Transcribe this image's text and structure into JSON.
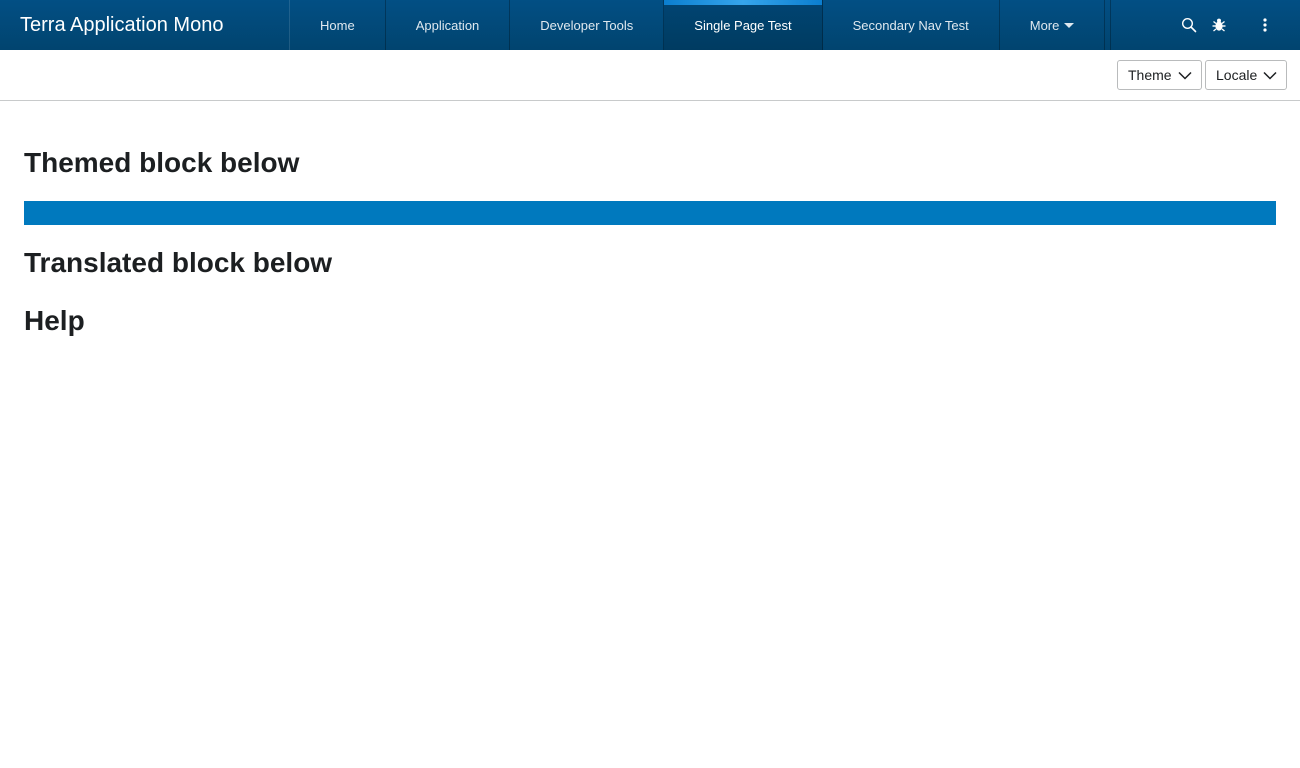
{
  "header": {
    "app_title": "Terra Application Mono",
    "tabs": [
      {
        "label": "Home",
        "active": false
      },
      {
        "label": "Application",
        "active": false
      },
      {
        "label": "Developer Tools",
        "active": false
      },
      {
        "label": "Single Page Test",
        "active": true
      },
      {
        "label": "Secondary Nav Test",
        "active": false
      },
      {
        "label": "More",
        "active": false
      }
    ],
    "utility_icons": [
      "search-icon",
      "bug-icon",
      "more-vertical-icon"
    ]
  },
  "toolbar": {
    "theme_label": "Theme",
    "locale_label": "Locale"
  },
  "main": {
    "themed_heading": "Themed block below",
    "translated_heading": "Translated block below",
    "help_heading": "Help"
  },
  "colors": {
    "header_bg": "#014979",
    "active_tab_indicator": "#36a5ec",
    "themed_block": "#0079be"
  }
}
